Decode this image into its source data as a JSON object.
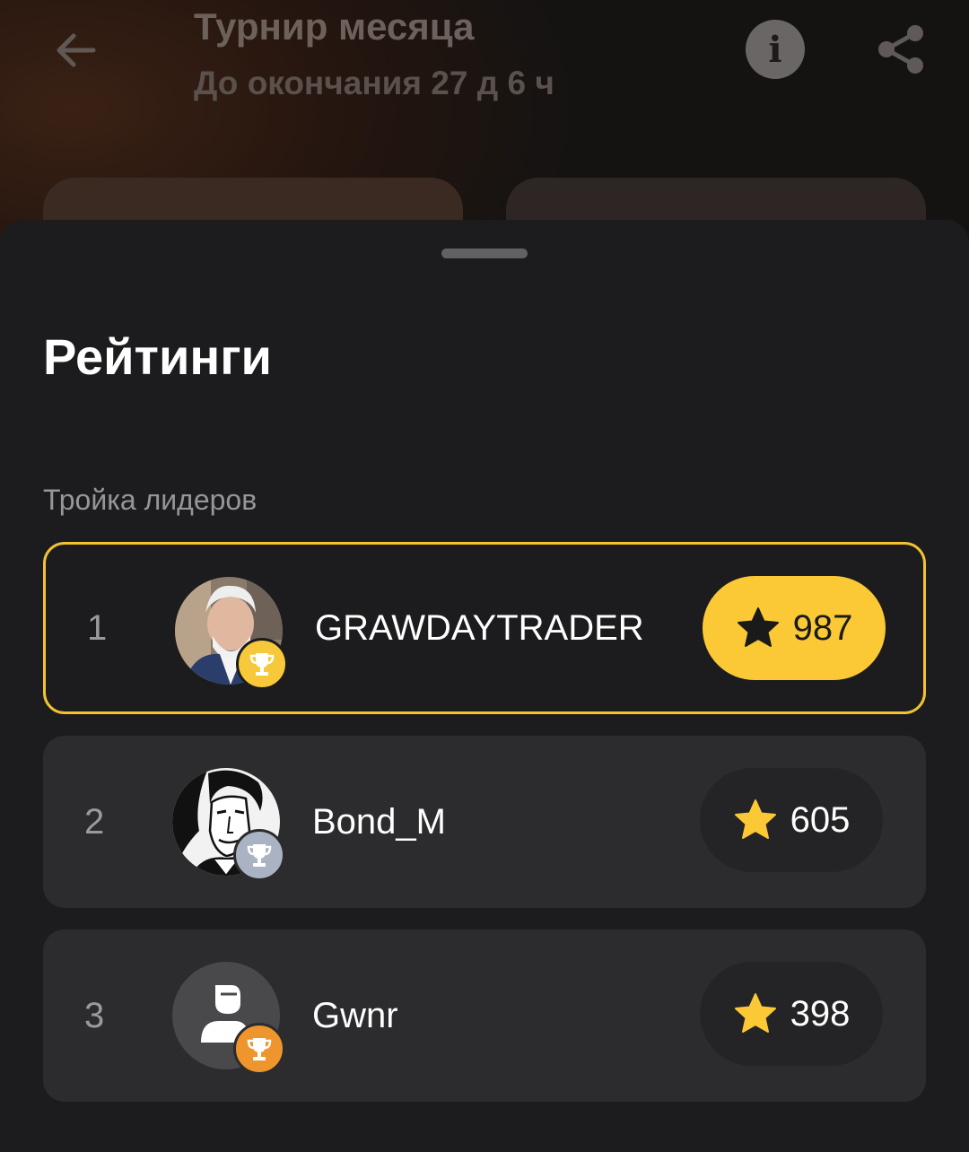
{
  "header": {
    "title": "Турнир месяца",
    "subtitle": "До окончания 27 д 6 ч",
    "info_icon": "i"
  },
  "sheet": {
    "title": "Рейтинги",
    "section_label": "Тройка лидеров"
  },
  "leaders": [
    {
      "rank": "1",
      "name": "GRAWDAYTRADER",
      "score": "987",
      "cup_color": "#f7c93a",
      "highlighted": true
    },
    {
      "rank": "2",
      "name": "Bond_M",
      "score": "605",
      "cup_color": "#aab3c3",
      "highlighted": false
    },
    {
      "rank": "3",
      "name": "Gwnr",
      "score": "398",
      "cup_color": "#ee962d",
      "highlighted": false
    }
  ],
  "colors": {
    "accent": "#fbc935",
    "sheet_bg": "#1c1c1e",
    "row_bg": "#2c2c2e",
    "highlight_border": "#f2c230"
  }
}
